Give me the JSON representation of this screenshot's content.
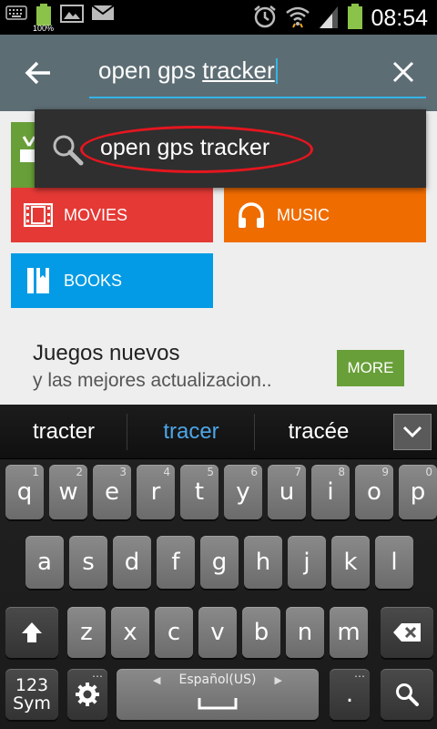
{
  "status_bar": {
    "battery_left_label": "100%",
    "time": "08:54",
    "icons": [
      "keyboard-icon",
      "battery-full-icon",
      "gallery-icon",
      "mail-icon",
      "alarm-icon",
      "wifi-icon",
      "signal-icon",
      "battery-charging-icon"
    ]
  },
  "action_bar": {
    "query_prefix": "open gps ",
    "query_underlined": "tracker",
    "colors": {
      "background": "#5d6d74",
      "underline": "#33b5e5"
    }
  },
  "suggestion": {
    "text": "open gps tracker",
    "icon": "search-icon",
    "highlight_color": "#e5161f"
  },
  "tiles": [
    {
      "label": "MOVIES",
      "icon": "film-icon",
      "color": "#e53935"
    },
    {
      "label": "MUSIC",
      "icon": "headphones-icon",
      "color": "#ef6c00"
    },
    {
      "label": "BOOKS",
      "icon": "book-icon",
      "color": "#039be5"
    }
  ],
  "section": {
    "title": "Juegos nuevos",
    "subtitle": "y las mejores actualizacion..",
    "more_label": "MORE"
  },
  "keyboard": {
    "predictions": [
      "tracter",
      "tracer",
      "tracée"
    ],
    "row1": [
      {
        "k": "q",
        "s": "1"
      },
      {
        "k": "w",
        "s": "2"
      },
      {
        "k": "e",
        "s": "3"
      },
      {
        "k": "r",
        "s": "4"
      },
      {
        "k": "t",
        "s": "5"
      },
      {
        "k": "y",
        "s": "6"
      },
      {
        "k": "u",
        "s": "7"
      },
      {
        "k": "i",
        "s": "8"
      },
      {
        "k": "o",
        "s": "9"
      },
      {
        "k": "p",
        "s": "0"
      }
    ],
    "row2": [
      "a",
      "s",
      "d",
      "f",
      "g",
      "h",
      "j",
      "k",
      "l"
    ],
    "row3": [
      "z",
      "x",
      "c",
      "v",
      "b",
      "n",
      "m"
    ],
    "sym_line1": "123",
    "sym_line2": "Sym",
    "space_language": "Español(US)",
    "period_label": "."
  }
}
